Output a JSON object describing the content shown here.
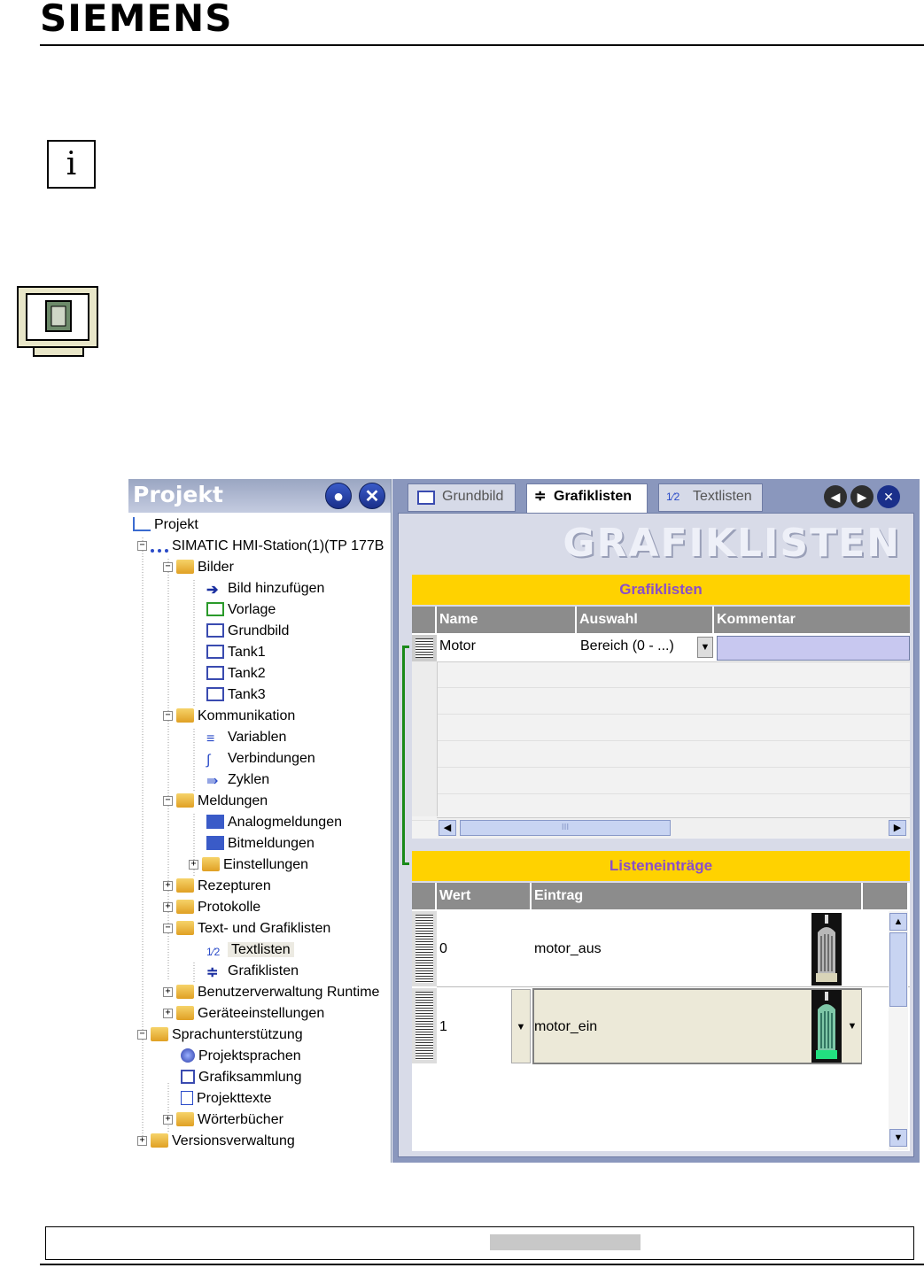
{
  "header": {
    "brand": "SIEMENS"
  },
  "info_icon": {
    "glyph": "i"
  },
  "project_panel": {
    "title": "Projekt",
    "tree": [
      {
        "label": "Projekt",
        "icon": "project-icon"
      },
      {
        "label": "SIMATIC HMI-Station(1)(TP 177B",
        "icon": "hmi-station-icon"
      },
      {
        "label": "Bilder",
        "icon": "folder-icon"
      },
      {
        "label": "Bild hinzufügen",
        "icon": "add-screen-icon"
      },
      {
        "label": "Vorlage",
        "icon": "template-icon"
      },
      {
        "label": "Grundbild",
        "icon": "screen-icon"
      },
      {
        "label": "Tank1",
        "icon": "screen-icon"
      },
      {
        "label": "Tank2",
        "icon": "screen-icon"
      },
      {
        "label": "Tank3",
        "icon": "screen-icon"
      },
      {
        "label": "Kommunikation",
        "icon": "folder-icon"
      },
      {
        "label": "Variablen",
        "icon": "tags-icon"
      },
      {
        "label": "Verbindungen",
        "icon": "connections-icon"
      },
      {
        "label": "Zyklen",
        "icon": "cycles-icon"
      },
      {
        "label": "Meldungen",
        "icon": "folder-icon"
      },
      {
        "label": "Analogmeldungen",
        "icon": "analog-alarm-icon"
      },
      {
        "label": "Bitmeldungen",
        "icon": "bit-alarm-icon"
      },
      {
        "label": "Einstellungen",
        "icon": "folder-icon"
      },
      {
        "label": "Rezepturen",
        "icon": "folder-icon"
      },
      {
        "label": "Protokolle",
        "icon": "folder-icon"
      },
      {
        "label": "Text- und Grafiklisten",
        "icon": "folder-icon"
      },
      {
        "label": "Textlisten",
        "icon": "textlist-icon"
      },
      {
        "label": "Grafiklisten",
        "icon": "graphiclist-icon"
      },
      {
        "label": "Benutzerverwaltung Runtime",
        "icon": "folder-icon"
      },
      {
        "label": "Geräteeinstellungen",
        "icon": "folder-icon"
      },
      {
        "label": "Sprachunterstützung",
        "icon": "folder-icon"
      },
      {
        "label": "Projektsprachen",
        "icon": "globe-icon"
      },
      {
        "label": "Grafiksammlung",
        "icon": "graphics-icon"
      },
      {
        "label": "Projekttexte",
        "icon": "texts-icon"
      },
      {
        "label": "Wörterbücher",
        "icon": "folder-icon"
      },
      {
        "label": "Versionsverwaltung",
        "icon": "folder-icon"
      }
    ]
  },
  "tabs": [
    {
      "label": "Grundbild"
    },
    {
      "label": "Grafiklisten"
    },
    {
      "label": "Textlisten"
    }
  ],
  "editor": {
    "big_title": "GRAFIKLISTEN",
    "section1_title": "Grafiklisten",
    "columns1": [
      "Name",
      "Auswahl",
      "Kommentar"
    ],
    "row1": {
      "name": "Motor",
      "auswahl": "Bereich (0 - ...)",
      "kommentar": ""
    },
    "scroll_thumb": "III",
    "section2_title": "Listeneinträge",
    "columns2": [
      "Wert",
      "Eintrag"
    ],
    "entries": [
      {
        "wert": "0",
        "eintrag": "motor_aus"
      },
      {
        "wert": "1",
        "eintrag": "motor_ein"
      }
    ]
  },
  "colors": {
    "accent_yellow": "#ffd200",
    "header_purple": "#8a4fc8",
    "frame_blue": "#8a97bd"
  }
}
